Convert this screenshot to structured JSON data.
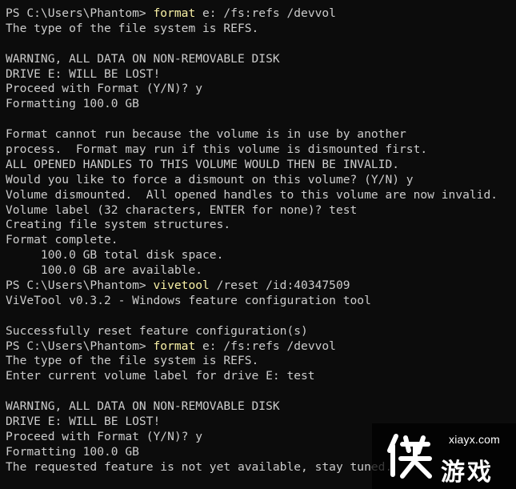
{
  "terminal": {
    "lines": [
      {
        "prompt": "PS C:\\Users\\Phantom> ",
        "cmd": "format",
        "args": " e: /fs:refs /devvol"
      },
      {
        "text": "The type of the file system is REFS."
      },
      {
        "text": ""
      },
      {
        "text": "WARNING, ALL DATA ON NON-REMOVABLE DISK"
      },
      {
        "text": "DRIVE E: WILL BE LOST!"
      },
      {
        "text": "Proceed with Format (Y/N)? y"
      },
      {
        "text": "Formatting 100.0 GB"
      },
      {
        "text": ""
      },
      {
        "text": "Format cannot run because the volume is in use by another"
      },
      {
        "text": "process.  Format may run if this volume is dismounted first."
      },
      {
        "text": "ALL OPENED HANDLES TO THIS VOLUME WOULD THEN BE INVALID."
      },
      {
        "text": "Would you like to force a dismount on this volume? (Y/N) y"
      },
      {
        "text": "Volume dismounted.  All opened handles to this volume are now invalid."
      },
      {
        "text": "Volume label (32 characters, ENTER for none)? test"
      },
      {
        "text": "Creating file system structures."
      },
      {
        "text": "Format complete."
      },
      {
        "text": "     100.0 GB total disk space."
      },
      {
        "text": "     100.0 GB are available."
      },
      {
        "prompt": "PS C:\\Users\\Phantom> ",
        "cmd": "vivetool",
        "args": " /reset /id:40347509"
      },
      {
        "text": "ViVeTool v0.3.2 - Windows feature configuration tool"
      },
      {
        "text": ""
      },
      {
        "text": "Successfully reset feature configuration(s)"
      },
      {
        "prompt": "PS C:\\Users\\Phantom> ",
        "cmd": "format",
        "args": " e: /fs:refs /devvol"
      },
      {
        "text": "The type of the file system is REFS."
      },
      {
        "text": "Enter current volume label for drive E: test"
      },
      {
        "text": ""
      },
      {
        "text": "WARNING, ALL DATA ON NON-REMOVABLE DISK"
      },
      {
        "text": "DRIVE E: WILL BE LOST!"
      },
      {
        "text": "Proceed with Format (Y/N)? y"
      },
      {
        "text": "Formatting 100.0 GB"
      },
      {
        "text": "The requested feature is not yet available, stay tuned."
      }
    ]
  },
  "watermark": {
    "url": "xiayx.com",
    "brand": "游戏",
    "logo_icon": "xia-character-logo"
  },
  "colors": {
    "background": "#0c0c0c",
    "text": "#cccccc",
    "command": "#f9f1a5"
  }
}
